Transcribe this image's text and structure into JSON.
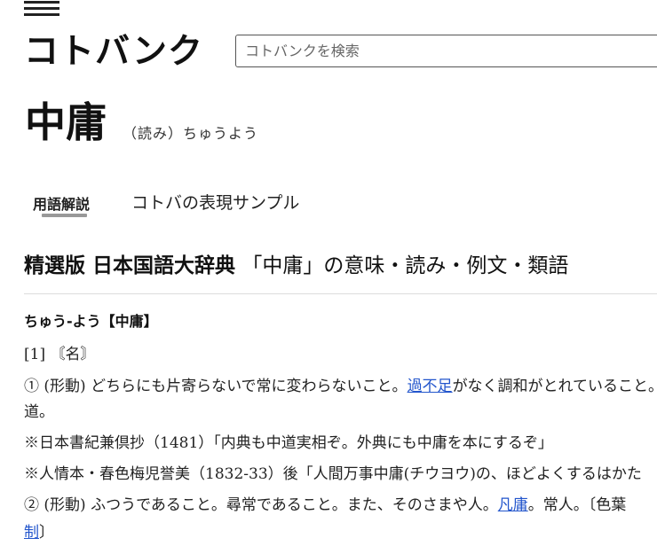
{
  "header": {
    "logo_text": "コトバンク",
    "search_placeholder": "コトバンクを検索"
  },
  "entry": {
    "headword": "中庸",
    "reading": "（読み）ちゅうよう"
  },
  "tabs": [
    {
      "label": "用語解説",
      "active": true
    },
    {
      "label": "コトバの表現サンプル",
      "active": false
    }
  ],
  "section": {
    "book": "精選版 日本国語大辞典",
    "rest": "「中庸」の意味・読み・例文・類語"
  },
  "definition": {
    "head": "ちゅう‐よう【中庸】",
    "line1": "[1] 〘名〙",
    "line2_a": "① (形動) どちらにも片寄らないで常に変わらないこと。",
    "line2_link": "過不足",
    "line2_b": "がなく調和がとれていること。",
    "line3": "道。",
    "line4": "※日本書紀兼倶抄（1481）「内典も中道実相ぞ。外典にも中庸を本にするぞ」",
    "line5": "※人情本・春色梅児誉美（1832‐33）後「人間万事中庸(チウヨウ)の、ほどよくするはかた",
    "line6_a": "② (形動) ふつうであること。尋常であること。また、そのさまや人。",
    "line6_link": "凡庸",
    "line6_b": "。常人。〔色葉",
    "line7_link": "制",
    "line7_b": "〕"
  },
  "colors": {
    "link": "#2255cc",
    "tab_underline": "#999999",
    "divider": "#dddddd"
  }
}
